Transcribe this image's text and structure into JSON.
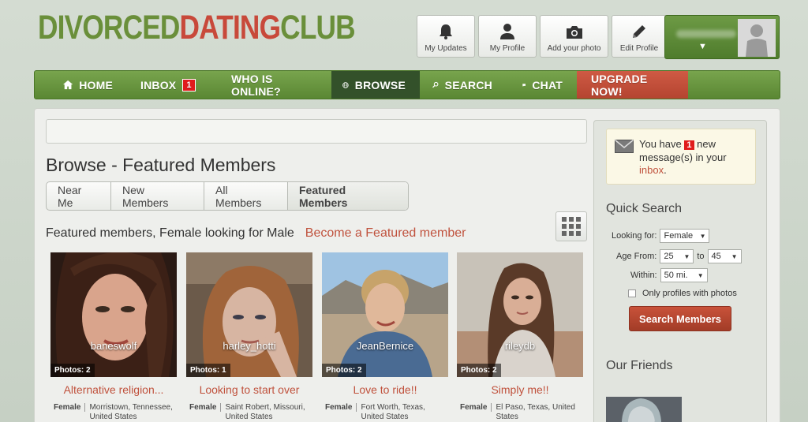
{
  "logo": {
    "part1": "DIVORCED",
    "part2": "DATING",
    "part3": "CLUB"
  },
  "tools": [
    {
      "label": "My Updates",
      "icon": "bell-icon"
    },
    {
      "label": "My Profile",
      "icon": "person-icon"
    },
    {
      "label": "Add your photo",
      "icon": "camera-icon"
    },
    {
      "label": "Edit Profile",
      "icon": "pencil-icon"
    }
  ],
  "user_menu": {
    "caret": "▼"
  },
  "nav": {
    "home": "HOME",
    "inbox": "INBOX",
    "inbox_count": "1",
    "who": "WHO IS ONLINE?",
    "browse": "BROWSE",
    "search": "SEARCH",
    "chat": "CHAT",
    "upgrade": "UPGRADE NOW!"
  },
  "colors": {
    "nav_green": "#6a9640",
    "active_nav": "#33512a",
    "accent_red": "#c0523d",
    "badge_red": "#e01c1c"
  },
  "main": {
    "title": "Browse - Featured Members",
    "tabs": [
      "Near Me",
      "New Members",
      "All Members",
      "Featured Members"
    ],
    "subhead": "Featured members, Female looking for Male",
    "become_link": "Become a Featured member"
  },
  "members": [
    {
      "username": "baneswolf",
      "photos": "Photos: 2",
      "tagline": "Alternative religion...",
      "gender": "Female",
      "location": "Morristown, Tennessee, United States"
    },
    {
      "username": "harley_hotti",
      "photos": "Photos: 1",
      "tagline": "Looking to start over",
      "gender": "Female",
      "location": "Saint Robert, Missouri, United States"
    },
    {
      "username": "JeanBernice",
      "photos": "Photos: 2",
      "tagline": "Love to ride!!",
      "gender": "Female",
      "location": "Fort Worth, Texas, United States"
    },
    {
      "username": "rileydb",
      "photos": "Photos: 2",
      "tagline": "Simply me!!",
      "gender": "Female",
      "location": "El Paso, Texas, United States"
    }
  ],
  "sidebar": {
    "msg_pre": "You have",
    "msg_count": "1",
    "msg_mid": "new message(s) in your",
    "msg_link": "inbox",
    "msg_end": ".",
    "quick_search": "Quick Search",
    "looking_for_label": "Looking for:",
    "looking_for_value": "Female",
    "age_from_label": "Age From:",
    "age_from_value": "25",
    "age_to_label": "to",
    "age_to_value": "45",
    "within_label": "Within:",
    "within_value": "50 mi.",
    "photos_only_label": "Only profiles with photos",
    "search_button": "Search Members",
    "friends_title": "Our Friends"
  }
}
